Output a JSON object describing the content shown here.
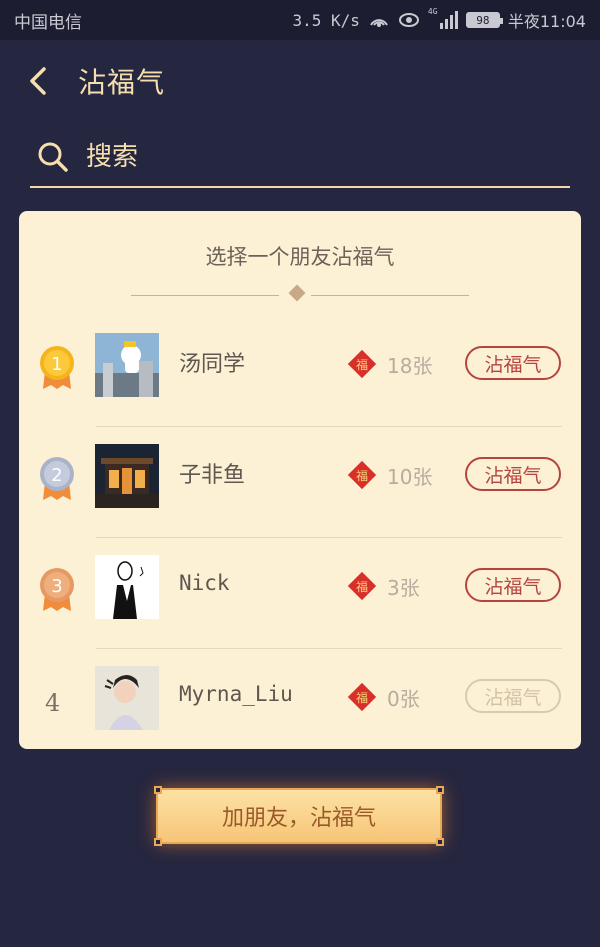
{
  "status_bar": {
    "carrier": "中国电信",
    "speed": "3.5 K/s",
    "network": "4G",
    "battery": "98",
    "time": "半夜11:04"
  },
  "header": {
    "title": "沾福气"
  },
  "search": {
    "placeholder": "搜索"
  },
  "card": {
    "title": "选择一个朋友沾福气",
    "friends": [
      {
        "rank": "1",
        "name": "汤同学",
        "count": "18张",
        "button": "沾福气",
        "enabled": true
      },
      {
        "rank": "2",
        "name": "子非鱼",
        "count": "10张",
        "button": "沾福气",
        "enabled": true
      },
      {
        "rank": "3",
        "name": "Nick",
        "count": "3张",
        "button": "沾福气",
        "enabled": true
      },
      {
        "rank": "4",
        "name": "Myrna_Liu",
        "count": "0张",
        "button": "沾福气",
        "enabled": false
      }
    ]
  },
  "add_friend_button": "加朋友，沾福气",
  "colors": {
    "background": "#252640",
    "accent_gold": "#f6dfae",
    "card": "#fdf1d5",
    "button_red": "#b5443e"
  }
}
